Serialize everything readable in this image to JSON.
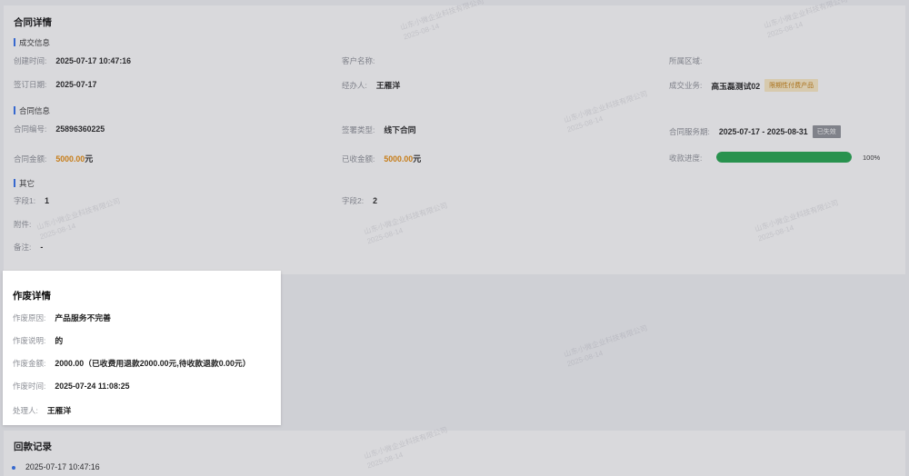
{
  "contract_card": {
    "title": "合同详情",
    "deal_section": {
      "title": "成交信息",
      "create_time": {
        "label": "创建时间:",
        "value": "2025-07-17 10:47:16"
      },
      "customer_name": {
        "label": "客户名称:",
        "value": ""
      },
      "region": {
        "label": "所属区域:",
        "value": ""
      },
      "sign_date": {
        "label": "签订日期:",
        "value": "2025-07-17"
      },
      "handler": {
        "label": "经办人:",
        "value": "王雁洋"
      },
      "deal_business": {
        "label": "成交业务:",
        "value": "高玉磊测试02",
        "tag": "限期性付费产品"
      }
    },
    "contract_section": {
      "title": "合同信息",
      "contract_no": {
        "label": "合同编号:",
        "value": "25896360225"
      },
      "sign_type": {
        "label": "签署类型:",
        "value": "线下合同"
      },
      "service_period": {
        "label": "合同服务期:",
        "value": "2025-07-17 - 2025-08-31",
        "tag": "已失效"
      },
      "amount": {
        "label": "合同金额:",
        "value": "5000.00",
        "unit": "元"
      },
      "received": {
        "label": "已收金额:",
        "value": "5000.00",
        "unit": "元"
      },
      "progress": {
        "label": "收款进度:",
        "percent": 100,
        "text": "100%"
      }
    },
    "other_section": {
      "title": "其它",
      "field1": {
        "label": "字段1:",
        "value": "1"
      },
      "field2": {
        "label": "字段2:",
        "value": "2"
      },
      "attachment": {
        "label": "附件:",
        "value": ""
      },
      "remark": {
        "label": "备注:",
        "value": "-"
      }
    }
  },
  "void_modal": {
    "title": "作废详情",
    "reason": {
      "label": "作废原因:",
      "value": "产品服务不完善"
    },
    "description": {
      "label": "作废说明:",
      "value": "的"
    },
    "amount": {
      "label": "作废金额:",
      "value": "2000.00（已收费用退款2000.00元,待收款退款0.00元）"
    },
    "time": {
      "label": "作废时间:",
      "value": "2025-07-24 11:08:25"
    },
    "handler": {
      "label": "处理人:",
      "value": "王雁洋"
    }
  },
  "payback_card": {
    "title": "回款记录",
    "records": [
      {
        "time": "2025-07-17 10:47:16"
      }
    ]
  },
  "colors": {
    "accent": "#2f6fed",
    "money": "#e88a06",
    "progress_fill": "#1da54a",
    "tag_yellow_bg": "#fdecc4",
    "tag_gray_bg": "#8d9096"
  },
  "watermark": {
    "line1": "山东小微企业科技有限公司",
    "line2": "2025-08-14"
  }
}
